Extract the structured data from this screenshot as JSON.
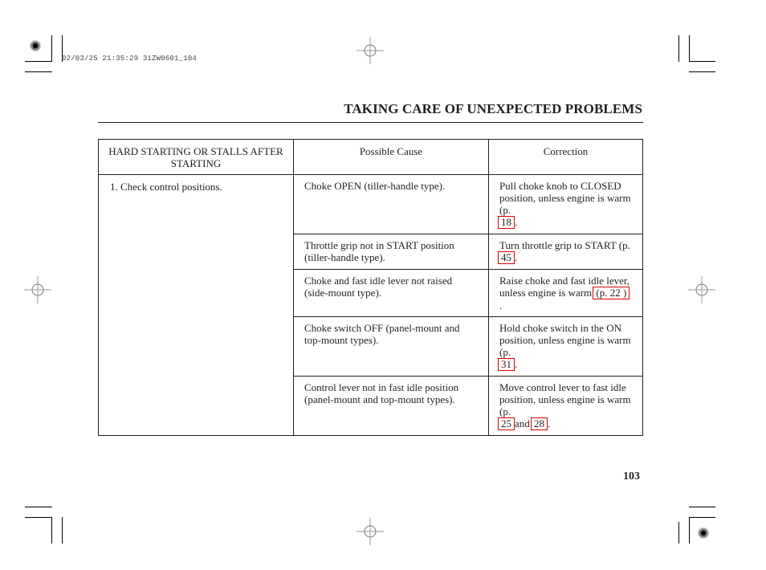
{
  "slug": "02/03/25 21:35:29 31ZW0601_104",
  "header": {
    "title": "TAKING CARE OF UNEXPECTED PROBLEMS"
  },
  "table": {
    "headers": {
      "symptom": "HARD STARTING OR STALLS AFTER STARTING",
      "cause": "Possible Cause",
      "correction": "Correction"
    },
    "check": "1. Check control positions.",
    "rows": [
      {
        "cause": "Choke OPEN (tiller-handle type).",
        "correction_pre": "Pull choke knob to CLOSED position, unless engine is warm (p.",
        "ref1": " 18 ",
        "correction_post": "."
      },
      {
        "cause": "Throttle grip not in START position (tiller-handle type).",
        "correction_pre": "Turn throttle grip to START (p.",
        "ref1": " 45 ",
        "correction_post": "."
      },
      {
        "cause": "Choke and fast idle lever not raised (side-mount type).",
        "correction_pre": "Raise choke and fast idle lever, unless engine is warm",
        "ref1": "(p. 22 )",
        "correction_post": "."
      },
      {
        "cause": "Choke switch OFF (panel-mount and top-mount types).",
        "correction_pre": "Hold choke switch in the ON position, unless engine is warm (p.",
        "ref1": " 31 ",
        "correction_post": "."
      },
      {
        "cause": "Control lever not in fast idle position (panel-mount and top-mount types).",
        "correction_pre": "Move control lever to fast idle position, unless engine is warm (p.",
        "ref1": " 25",
        "correction_mid": "and",
        "ref2": "28 ",
        "correction_post": "."
      }
    ]
  },
  "page_number": "103",
  "colors": {
    "link_box": "#e00000",
    "text": "#231f20"
  }
}
